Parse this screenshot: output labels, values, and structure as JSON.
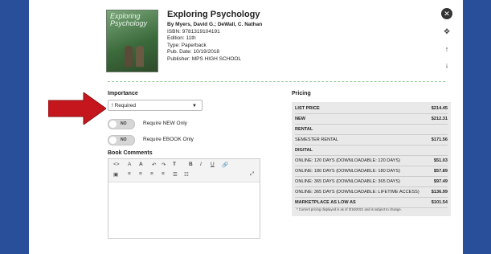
{
  "book": {
    "cover_text": "Exploring Psychology",
    "title": "Exploring Psychology",
    "byline": "By Myers, David G.; DeWall, C. Nathan",
    "isbn": "ISBN: 9781319104191",
    "edition": "Edition: 11th",
    "type": "Type: Paperback",
    "pub_date": "Pub. Date: 10/19/2018",
    "publisher": "Publisher: MPS HIGH SCHOOL"
  },
  "controls": {
    "close": "✕",
    "move": "✥",
    "up": "↑",
    "down": "↓"
  },
  "importance": {
    "label": "Importance",
    "selected": "! Required",
    "toggle_new_state": "NO",
    "toggle_new_label": "Require NEW Only",
    "toggle_ebook_state": "NO",
    "toggle_ebook_label": "Require EBOOK Only"
  },
  "comments": {
    "label": "Book Comments",
    "toolbar_row1": [
      "<>",
      "A",
      "A",
      "↶",
      "↷",
      "T",
      "B",
      "I",
      "U",
      "🔗"
    ],
    "toolbar_row2": [
      "▣",
      "≡",
      "≡",
      "≡",
      "≡",
      "☰",
      "☷",
      "⤢"
    ]
  },
  "pricing": {
    "label": "Pricing",
    "rows": [
      {
        "label": "LIST PRICE",
        "value": "$214.45",
        "bold": true
      },
      {
        "label": "NEW",
        "value": "$212.31",
        "bold": true
      },
      {
        "label": "RENTAL",
        "value": "",
        "bold": true
      },
      {
        "label": "SEMESTER RENTAL",
        "value": "$171.56",
        "bold": false
      },
      {
        "label": "DIGITAL",
        "value": "",
        "bold": true
      },
      {
        "label": "ONLINE: 120 DAYS (DOWNLOADABLE: 120 DAYS)",
        "value": "$51.03",
        "bold": false
      },
      {
        "label": "ONLINE: 180 DAYS (DOWNLOADABLE: 180 DAYS)",
        "value": "$57.89",
        "bold": false
      },
      {
        "label": "ONLINE: 365 DAYS (DOWNLOADABLE: 365 DAYS)",
        "value": "$97.49",
        "bold": false
      },
      {
        "label": "ONLINE: 365 DAYS (DOWNLOADABLE: LIFETIME ACCESS)",
        "value": "$136.99",
        "bold": false
      },
      {
        "label": "MARKETPLACE AS LOW AS",
        "value": "$101.54",
        "bold": true
      }
    ],
    "note": "* Current pricing displayed is as of 3/16/2021 and is subject to change."
  },
  "colors": {
    "background": "#2a4f9a",
    "arrow": "#c4161c",
    "divider": "#99cc99"
  }
}
